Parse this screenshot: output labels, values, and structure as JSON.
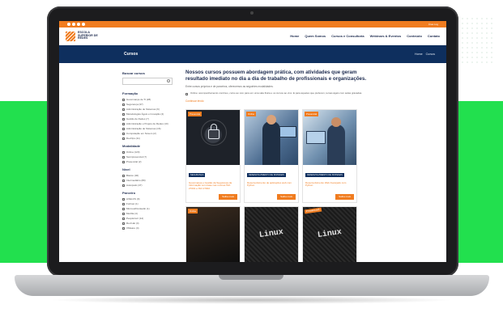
{
  "colors": {
    "accent": "#f07c1f",
    "brand_navy": "#0e2f5e",
    "background_green": "#22e04e"
  },
  "topbar": {
    "login_label": "Área Log",
    "social_icons": [
      "facebook-icon",
      "instagram-icon",
      "linkedin-icon",
      "youtube-icon"
    ]
  },
  "header": {
    "logo_text": "ESCOLA SUPERIOR DE REDES",
    "nav": [
      "Home",
      "Quem Somos",
      "Cursos e Consultoria",
      "Webinars & Eventos",
      "Conteúdo",
      "Contato"
    ]
  },
  "pagebar": {
    "title": "Cursos",
    "breadcrumb": [
      "Home",
      "Cursos"
    ]
  },
  "sidebar": {
    "search_label": "Buscar cursos",
    "groups": [
      {
        "title": "Formação",
        "items": [
          "Governança de TI (28)",
          "Segurança (37)",
          "Administração de Sistemas (6)",
          "Metodologias Ágeis e Inovação (4)",
          "Gestão de Redes (7)",
          "Administração e Projeto de Redes (10)",
          "Administração de Sistemas (16)",
          "Computação em Nuvem (2)",
          "DevOps (11)"
        ]
      },
      {
        "title": "Modalidade",
        "items": [
          "Online (120)",
          "Semipresencial (7)",
          "Presencial (2)"
        ]
      },
      {
        "title": "Nível",
        "items": [
          "Básico (40)",
          "Intermediário (80)",
          "Avançado (47)"
        ]
      },
      {
        "title": "Parceiro",
        "items": [
          "AXELOS (9)",
          "Fortinet (1)",
          "Microsoft/Linkedin (1)",
          "Mozilla (4)",
          "PeopleCert (12)",
          "Red Hat (4)",
          "VMware (4)"
        ]
      }
    ]
  },
  "main": {
    "headline": "Nossos cursos possuem abordagem prática, com atividades que geram resultado imediato no dia a dia de trabalho de profissionais e organizações.",
    "subline": "Entre cursos próprios e de parceiros, oferecemos as seguintes modalidades:",
    "bullet": "Online: acompanhamento contínuo, curso ao vivo para em uma sala física e os cursos ao vivo. E para aqueles que preferem, temas ágeis com aulas gravadas.",
    "more_label": "Continuar lendo",
    "cards": [
      {
        "tag": "Presencial",
        "category": "SEGURANÇA",
        "title": "Governança e Gestão da Segurança da Informação com base nas normas ISO 27001 e ISO 27002",
        "button": "Saiba mais"
      },
      {
        "tag": "Online",
        "category": "DESENVOLVIMENTO DE SISTEMAS",
        "title": "Desenvolvimento de aplicações web com Python",
        "button": "Saiba mais"
      },
      {
        "tag": "Presencial",
        "category": "DESENVOLVIMENTO DE SISTEMAS",
        "title": "Desenvolvimento Web Avançado com Python",
        "button": "Saiba mais"
      },
      {
        "tag": "Online",
        "category": "",
        "title": "",
        "button": ""
      },
      {
        "tag": "",
        "category": "",
        "title": "",
        "button": ""
      },
      {
        "tag": "Presencial",
        "category": "",
        "title": "",
        "button": ""
      }
    ],
    "linux_text": "Linux"
  }
}
